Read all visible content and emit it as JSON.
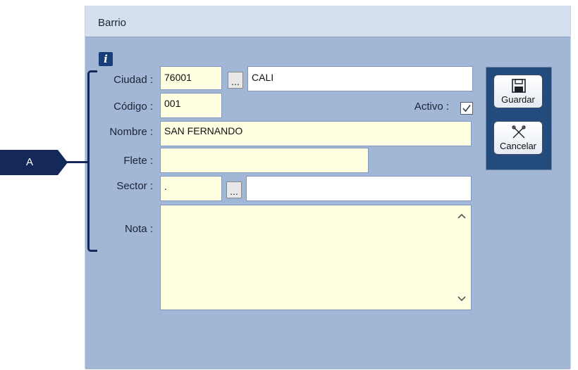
{
  "window": {
    "title": "Barrio"
  },
  "form": {
    "ciudad": {
      "label": "Ciudad :",
      "code": "76001",
      "name": "CALI",
      "lookup_label": "..."
    },
    "codigo": {
      "label": "Código :",
      "value": "001"
    },
    "activo": {
      "label": "Activo :",
      "checked": true
    },
    "nombre": {
      "label": "Nombre :",
      "value": "SAN FERNANDO"
    },
    "flete": {
      "label": "Flete :",
      "value": ""
    },
    "sector": {
      "label": "Sector :",
      "code": ".",
      "name": "",
      "lookup_label": "..."
    },
    "nota": {
      "label": "Nota :",
      "value": ""
    }
  },
  "actions": {
    "save_label": "Guardar",
    "cancel_label": "Cancelar"
  },
  "annotation": {
    "label": "A"
  },
  "icons": {
    "info": "info-icon",
    "save": "floppy-disk-icon",
    "cancel": "cancel-cross-icon",
    "check": "checkmark-icon"
  },
  "colors": {
    "field_background": "#ffffe2",
    "panel_background": "#a2b6d6",
    "accent_dark": "#234b7b",
    "annotation": "#14285a"
  }
}
